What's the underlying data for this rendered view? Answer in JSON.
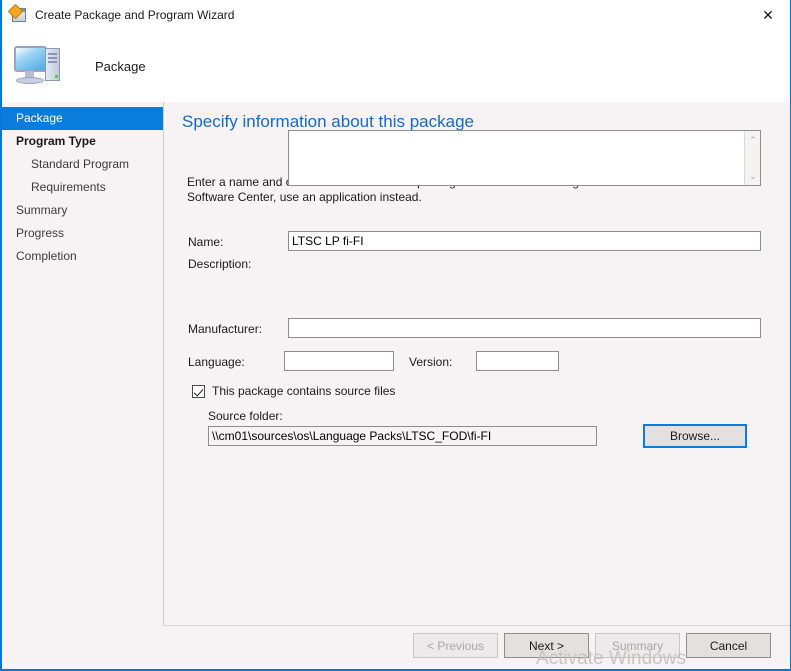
{
  "window": {
    "title": "Create Package and Program Wizard",
    "close_label": "✕",
    "icon": "package-wizard-icon",
    "accent_color": "#0078d7"
  },
  "header": {
    "label": "Package",
    "icon": "computer-icon"
  },
  "sidebar": {
    "items": [
      {
        "label": "Package",
        "selected": true,
        "bold": false,
        "indented": false
      },
      {
        "label": "Program Type",
        "selected": false,
        "bold": true,
        "indented": false
      },
      {
        "label": "Standard Program",
        "selected": false,
        "bold": false,
        "indented": true
      },
      {
        "label": "Requirements",
        "selected": false,
        "bold": false,
        "indented": true
      },
      {
        "label": "Summary",
        "selected": false,
        "bold": false,
        "indented": false
      },
      {
        "label": "Progress",
        "selected": false,
        "bold": false,
        "indented": false
      },
      {
        "label": "Completion",
        "selected": false,
        "bold": false,
        "indented": false
      }
    ],
    "selected_color": "#0a7cdb"
  },
  "content": {
    "title": "Specify information about this package",
    "title_color": "#1569c7",
    "description": "Enter a name and other details for the new package. To take full advantage of new features that include the Software Center, use an application instead.",
    "fields": {
      "name": {
        "label": "Name:",
        "value": "LTSC LP fi-FI",
        "placeholder": ""
      },
      "description": {
        "label": "Description:",
        "value": "",
        "placeholder": ""
      },
      "manufacturer": {
        "label": "Manufacturer:",
        "value": "",
        "placeholder": ""
      },
      "language": {
        "label": "Language:",
        "value": "",
        "placeholder": ""
      },
      "version": {
        "label": "Version:",
        "value": "",
        "placeholder": ""
      }
    },
    "source_checkbox": {
      "label": "This package contains source files",
      "checked": true
    },
    "source_folder": {
      "label": "Source folder:",
      "value": "\\\\cm01\\sources\\os\\Language Packs\\LTSC_FOD\\fi-FI",
      "placeholder": ""
    },
    "browse_button": {
      "label": "Browse...",
      "focused": true,
      "focus_color": "#0a7cdb"
    },
    "scrollbar": {
      "up_arrow": "⌃",
      "down_arrow": "⌄"
    }
  },
  "footer": {
    "buttons": [
      {
        "label": "< Previous",
        "enabled": false
      },
      {
        "label": "Next >",
        "enabled": true
      },
      {
        "label": "Summary",
        "enabled": false
      },
      {
        "label": "Cancel",
        "enabled": true
      }
    ]
  },
  "watermark": {
    "text": "Activate Windows"
  }
}
